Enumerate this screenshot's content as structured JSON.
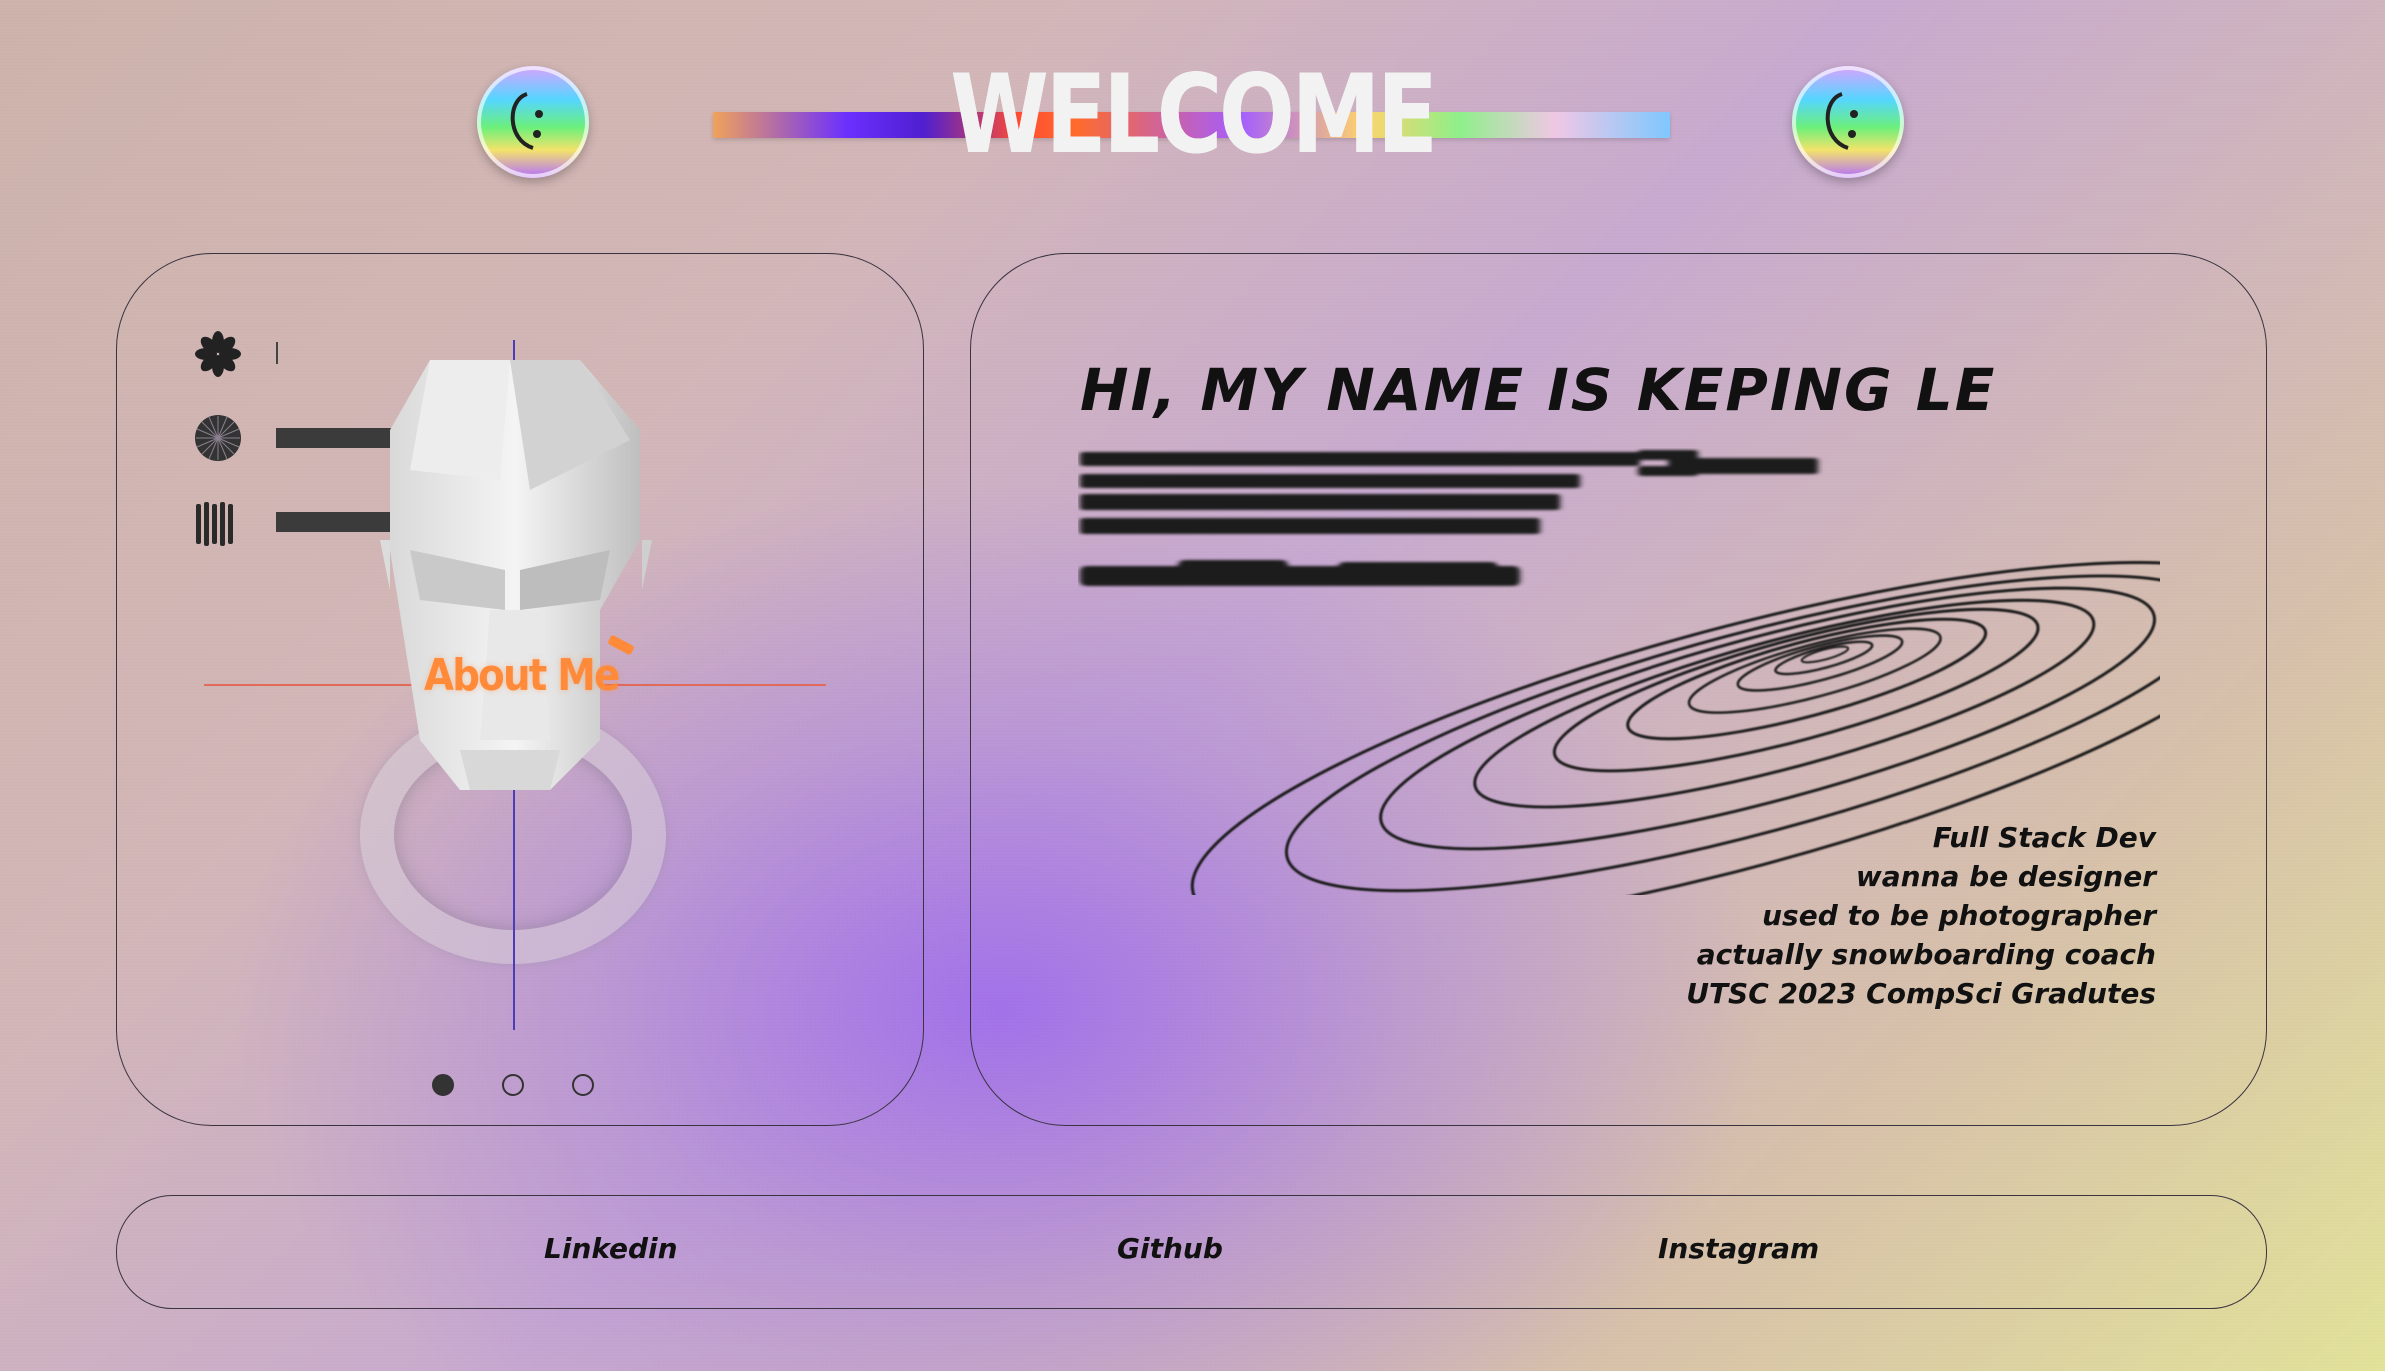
{
  "header": {
    "title": "WELCOME",
    "left_icon": "smiley-icon",
    "right_icon": "smiley-icon"
  },
  "about_panel": {
    "label": "About Me",
    "icons": [
      "asterisk-icon",
      "sunburst-icon",
      "barcode-icon"
    ],
    "pagination": {
      "total": 3,
      "active": 1
    }
  },
  "intro_panel": {
    "heading": "HI, MY NAME IS KEPING LE",
    "bio_lines": [
      "Full Stack Dev",
      "wanna be designer",
      "used to be photographer",
      "actually snowboarding coach",
      "UTSC 2023 CompSci Gradutes"
    ]
  },
  "footer": {
    "links": [
      "Linkedin",
      "Github",
      "Instagram"
    ]
  },
  "colors": {
    "accent_orange": "#ff8a3a",
    "text_dark": "#111111",
    "guide_red": "#e26a5a",
    "guide_blue": "#4b3cb9"
  }
}
